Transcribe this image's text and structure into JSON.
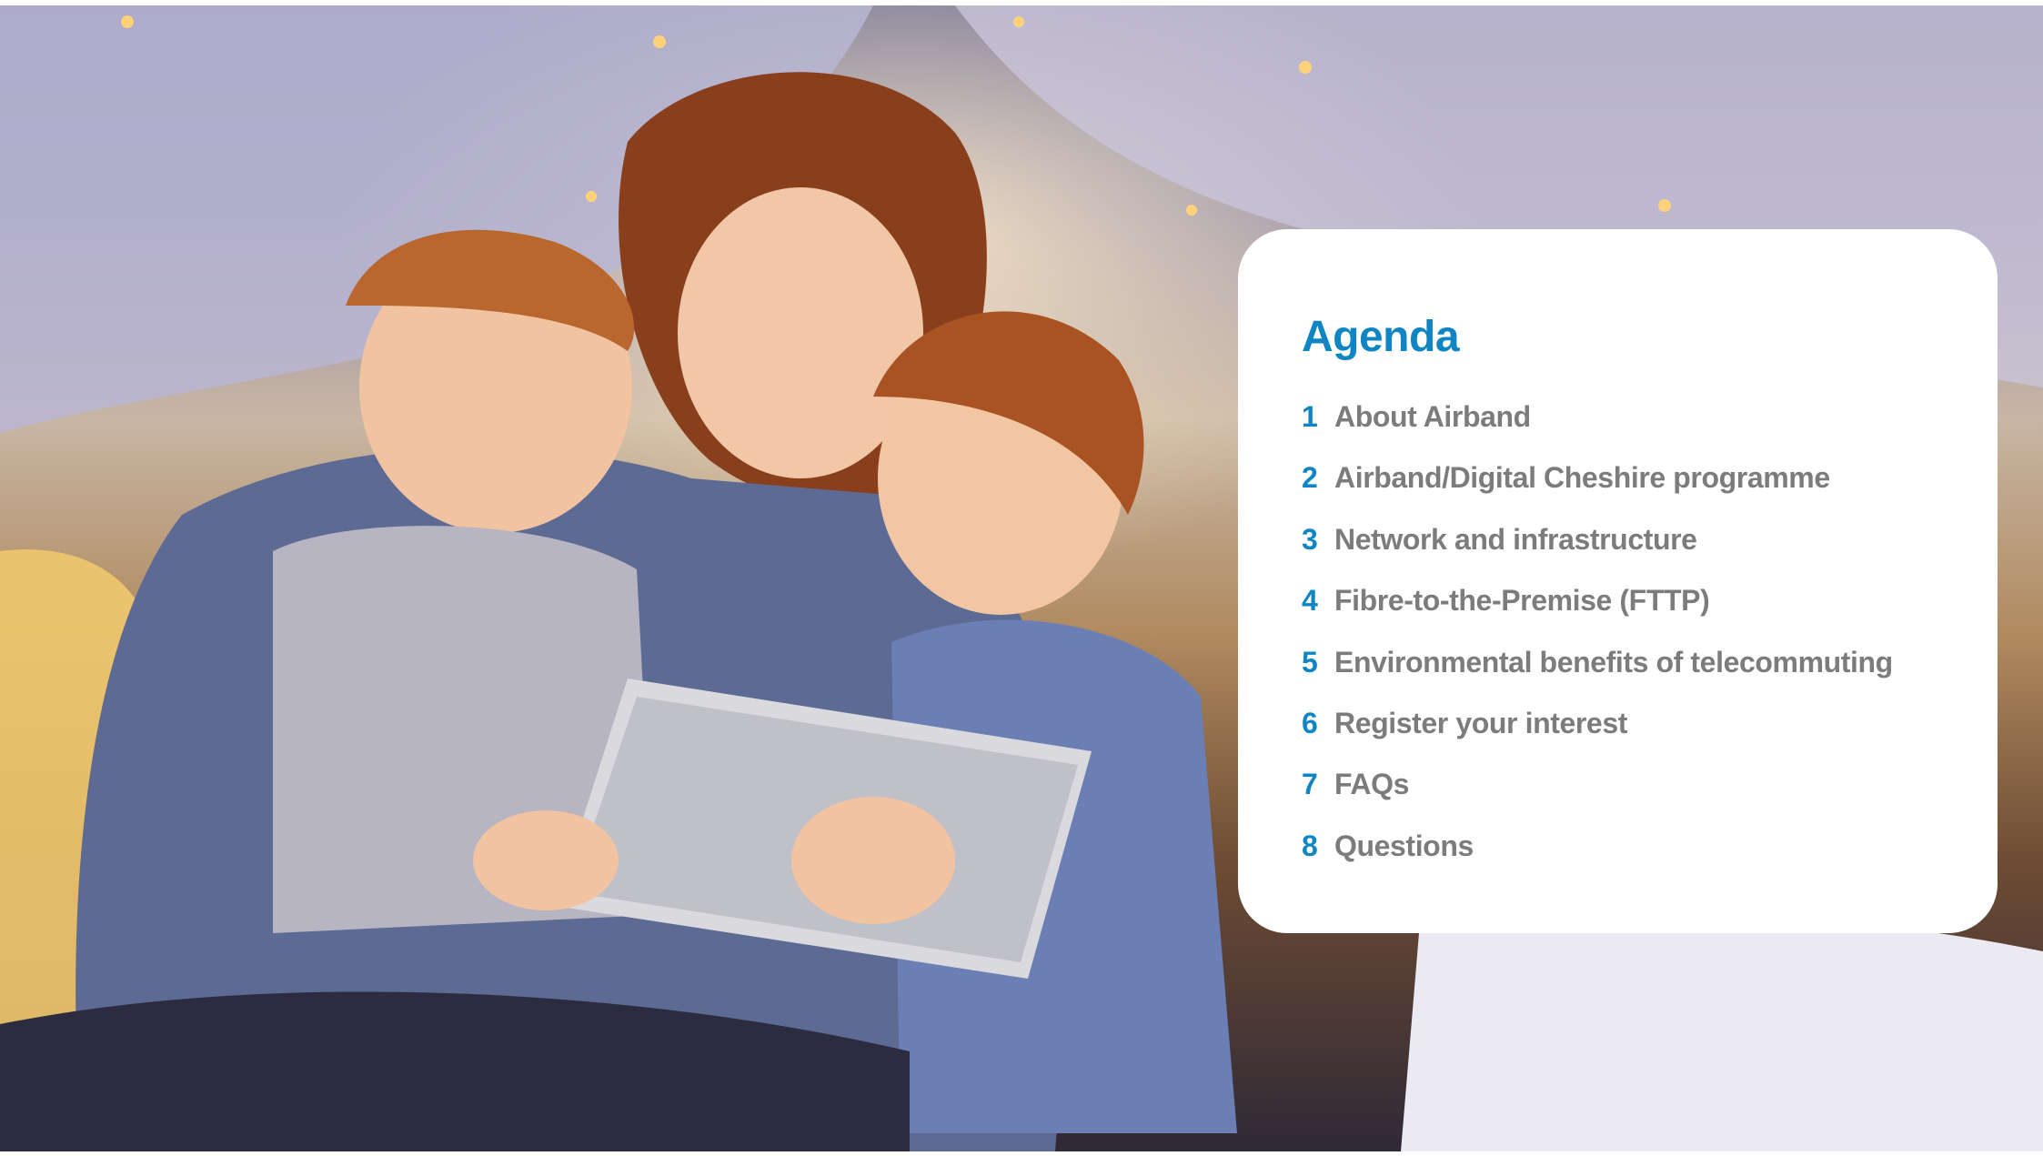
{
  "slide": {
    "background_image": "photo-mother-and-two-children-with-tablet-under-blanket-fort",
    "card": {
      "title": "Agenda",
      "items": [
        {
          "number": "1",
          "label": "About Airband"
        },
        {
          "number": "2",
          "label": "Airband/Digital Cheshire programme"
        },
        {
          "number": "3",
          "label": "Network and infrastructure"
        },
        {
          "number": "4",
          "label": "Fibre-to-the-Premise (FTTP)"
        },
        {
          "number": "5",
          "label": "Environmental benefits of telecommuting"
        },
        {
          "number": "6",
          "label": "Register your interest"
        },
        {
          "number": "7",
          "label": "FAQs"
        },
        {
          "number": "8",
          "label": "Questions"
        }
      ]
    }
  },
  "colors": {
    "accent": "#0f86c3",
    "item_text": "#7c7c7c",
    "card_background": "#ffffff"
  }
}
